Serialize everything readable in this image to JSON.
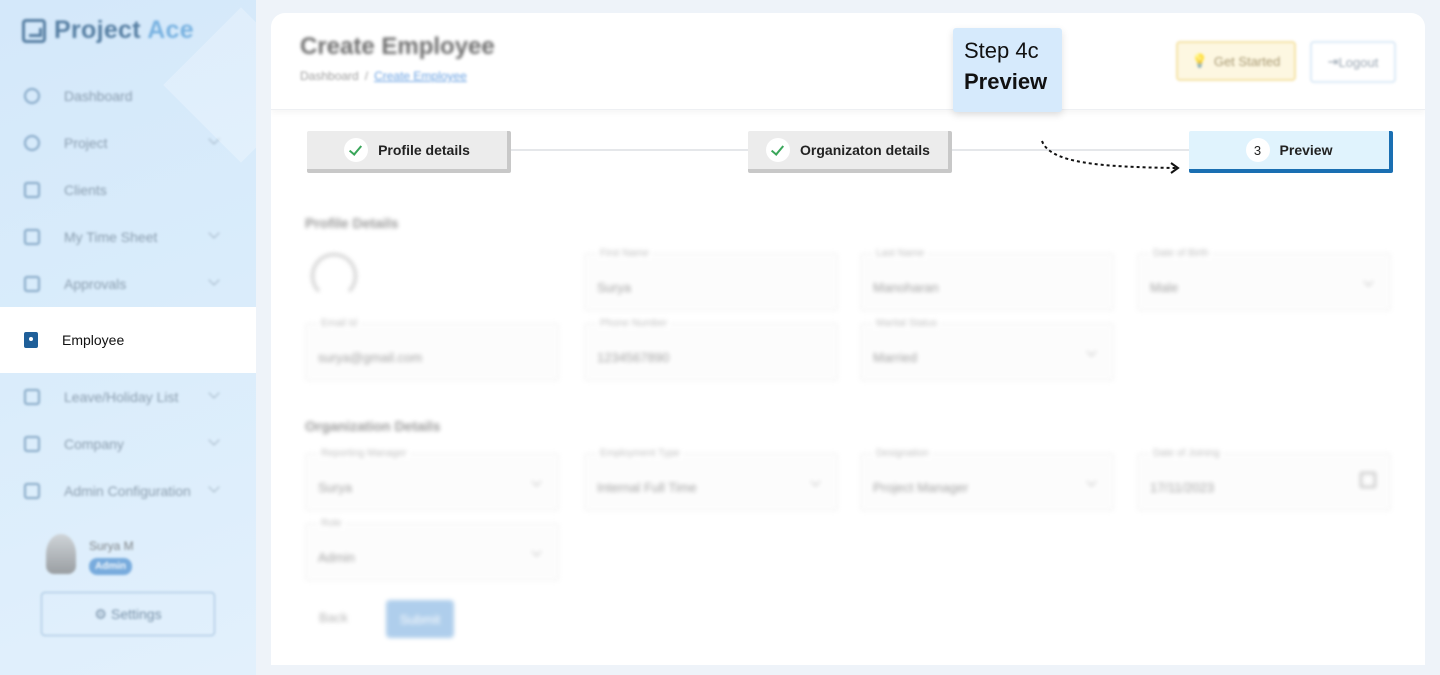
{
  "app": {
    "logo_text_primary": "Project",
    "logo_text_accent": "Ace"
  },
  "sidebar": {
    "items": [
      {
        "label": "Dashboard",
        "icon": "dashboard-icon",
        "has_submenu": false
      },
      {
        "label": "Project",
        "icon": "project-icon",
        "has_submenu": true
      },
      {
        "label": "Clients",
        "icon": "clients-icon",
        "has_submenu": false
      },
      {
        "label": "My Time Sheet",
        "icon": "timesheet-icon",
        "has_submenu": true
      },
      {
        "label": "Approvals",
        "icon": "approvals-icon",
        "has_submenu": true
      },
      {
        "label": "Employee",
        "icon": "employee-icon",
        "has_submenu": false,
        "active": true
      },
      {
        "label": "Leave/Holiday List",
        "icon": "leave-icon",
        "has_submenu": true
      },
      {
        "label": "Company",
        "icon": "company-icon",
        "has_submenu": true
      },
      {
        "label": "Admin Configuration",
        "icon": "admin-icon",
        "has_submenu": true
      }
    ],
    "user": {
      "name": "Surya M",
      "role": "Admin"
    },
    "settings_label": "Settings"
  },
  "header": {
    "title": "Create Employee",
    "breadcrumb": [
      "Dashboard",
      "Create Employee"
    ],
    "get_started_label": "Get Started",
    "logout_label": "Logout"
  },
  "stepper": {
    "steps": [
      {
        "label": "Profile details",
        "state": "completed"
      },
      {
        "label": "Organizaton details",
        "state": "completed"
      },
      {
        "label": "Preview",
        "number": "3",
        "state": "active"
      }
    ]
  },
  "callout": {
    "step": "Step 4c",
    "name": "Preview"
  },
  "form": {
    "profile_section_title": "Profile Details",
    "profile_fields": [
      {
        "label": "First Name",
        "value": "Surya"
      },
      {
        "label": "Last Name",
        "value": "Manoharan"
      },
      {
        "label": "Date of Birth",
        "value": "Male",
        "dropdown": true
      },
      {
        "label": "Email Id",
        "value": "surya@gmail.com"
      },
      {
        "label": "Phone Number",
        "value": "1234567890"
      },
      {
        "label": "Marital Status",
        "value": "Married",
        "dropdown": true
      }
    ],
    "org_section_title": "Organization Details",
    "org_fields": [
      {
        "label": "Reporting Manager",
        "value": "Surya",
        "dropdown": true
      },
      {
        "label": "Employment Type",
        "value": "Internal Full Time",
        "dropdown": true
      },
      {
        "label": "Designation",
        "value": "Project Manager",
        "dropdown": true
      },
      {
        "label": "Date of Joining",
        "value": "17/11/2023",
        "dropdown": false
      },
      {
        "label": "Role",
        "value": "Admin",
        "dropdown": true
      }
    ],
    "back_label": "Back",
    "next_label": "Submit"
  },
  "colors": {
    "sidebar_bg": "#d9ecfb",
    "active_step_bg": "#e0f3fd",
    "active_step_border": "#1a6fb2",
    "callout_bg": "#d6eafc",
    "check_green": "#3aa65a"
  }
}
